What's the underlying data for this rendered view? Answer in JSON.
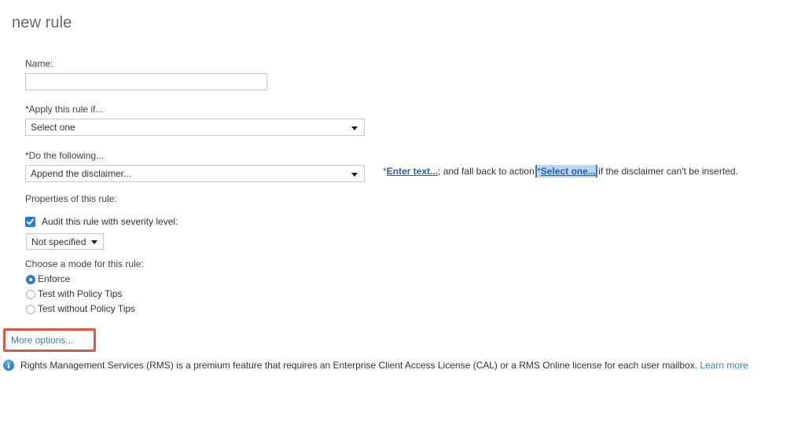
{
  "page": {
    "title": "new rule"
  },
  "form": {
    "name": {
      "label": "Name:",
      "value": "",
      "placeholder": ""
    },
    "apply_rule_if": {
      "label": "*Apply this rule if...",
      "selected": "Select one",
      "caret_icon": "chevron-down-icon"
    },
    "do_the_following": {
      "label": "*Do the following...",
      "selected": "Append the disclaimer...",
      "caret_icon": "chevron-down-icon"
    },
    "action_sentence": {
      "star1": "*",
      "enter_text_link": "Enter text...",
      "mid_text": "; and fall back to action ",
      "star2": "*",
      "select_one_link": "Select one...",
      "tail_text": " if the disclaimer can't be inserted."
    },
    "properties": {
      "title": "Properties of this rule:",
      "audit_checkbox": {
        "label": "Audit this rule with severity level:",
        "checked": true,
        "icon": "checkbox-checked-icon"
      },
      "severity": {
        "selected": "Not specified",
        "caret_icon": "chevron-down-icon"
      }
    },
    "mode": {
      "title": "Choose a mode for this rule:",
      "options": [
        {
          "label": "Enforce",
          "selected": true
        },
        {
          "label": "Test with Policy Tips",
          "selected": false
        },
        {
          "label": "Test without Policy Tips",
          "selected": false
        }
      ]
    },
    "more_options": {
      "label": "More options...",
      "highlight_color": "#e8523f"
    }
  },
  "info_bar": {
    "icon": "info-circle-icon",
    "text": "Rights Management Services (RMS) is a premium feature that requires an Enterprise Client Access License (CAL) or a RMS Online license for each user mailbox.",
    "learn_more": "Learn more"
  },
  "colors": {
    "accent_blue": "#2b7cd3",
    "link_blue": "#3b78c8",
    "callout_red": "#e8523f",
    "title_gray": "#666666"
  }
}
